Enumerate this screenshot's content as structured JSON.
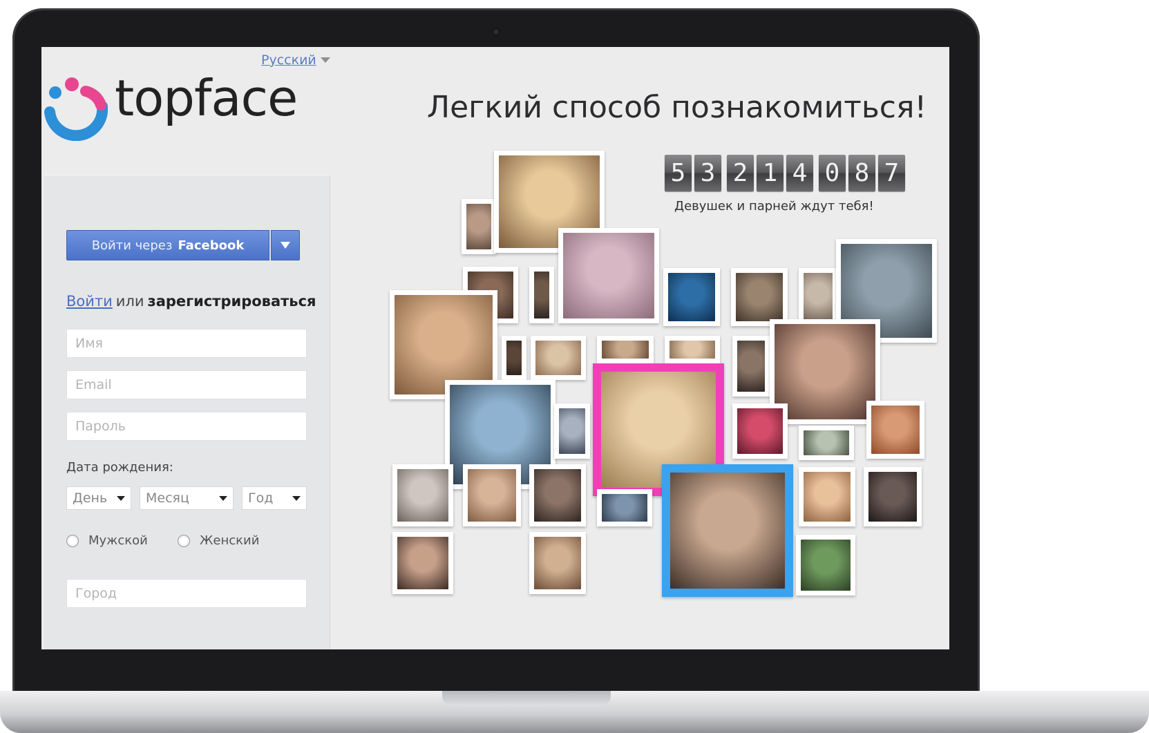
{
  "language": {
    "label": "Русский",
    "icon": "chevron-down-icon"
  },
  "brand": {
    "name": "topface",
    "colors": {
      "pink": "#e8468f",
      "blue": "#2d8fd8"
    }
  },
  "login": {
    "facebook_prefix": "Войти через",
    "facebook_brand": "Facebook",
    "login_link": "Войти",
    "or": "или",
    "register": "зарегистрироваться",
    "name_placeholder": "Имя",
    "email_placeholder": "Email",
    "password_placeholder": "Пароль",
    "dob_label": "Дата рождения:",
    "day": "День",
    "month": "Месяц",
    "year": "Год",
    "male": "Мужской",
    "female": "Женский",
    "city_placeholder": "Город"
  },
  "hero": {
    "headline": "Легкий способ познакомиться!",
    "counter_digits": [
      "5",
      "3",
      "2",
      "1",
      "4",
      "0",
      "8",
      "7"
    ],
    "counter_caption": "Девушек и парней ждут тебя!"
  },
  "colors": {
    "facebook_blue": "#4a72c8",
    "highlight_pink": "#f040b8",
    "highlight_blue": "#3aa2ee"
  }
}
